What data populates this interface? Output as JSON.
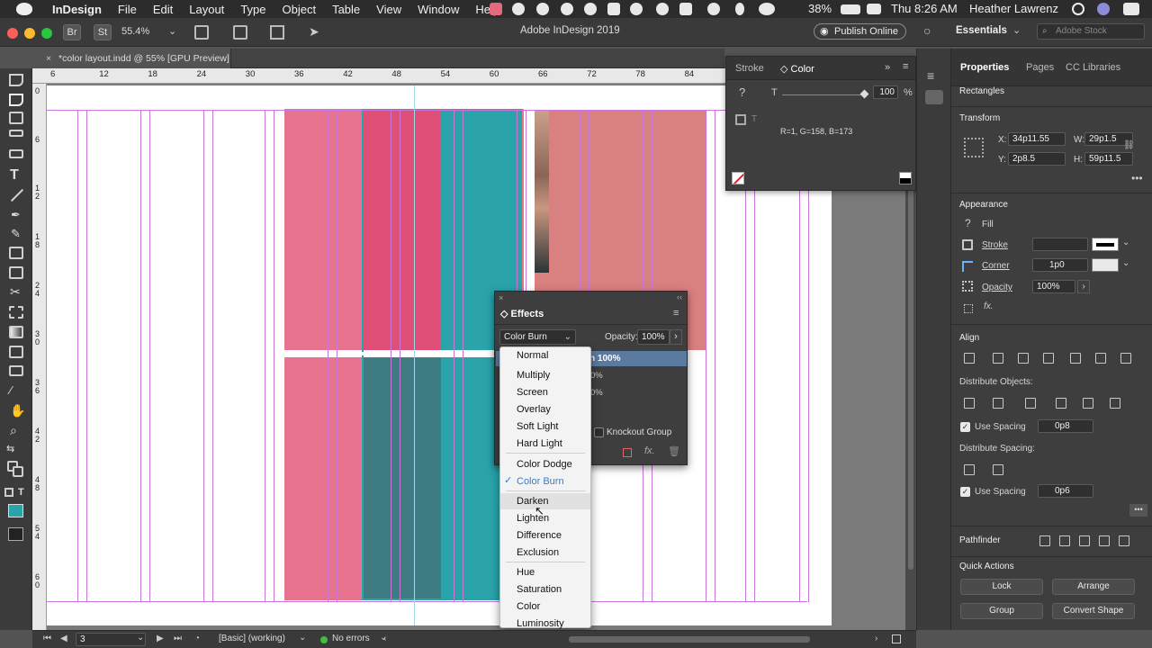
{
  "menubar": {
    "app_name": "InDesign",
    "menus": [
      "File",
      "Edit",
      "Layout",
      "Type",
      "Object",
      "Table",
      "View",
      "Window",
      "Help"
    ],
    "battery": "38%",
    "clock": "Thu 8:26 AM",
    "user": "Heather Lawrenz"
  },
  "app_bar": {
    "zoom": "55.4%",
    "title": "Adobe InDesign 2019",
    "publish_label": "Publish Online",
    "workspace": "Essentials",
    "search_placeholder": "Adobe Stock",
    "br_label": "Br",
    "st_label": "St"
  },
  "document_tab": {
    "title": "*color layout.indd @ 55% [GPU Preview]"
  },
  "ruler": {
    "h_ticks": [
      "6",
      "12",
      "18",
      "24",
      "30",
      "36",
      "42",
      "48",
      "54",
      "60",
      "66",
      "72",
      "78",
      "84"
    ],
    "v_ticks": [
      "0",
      "6",
      "1 2",
      "1 8",
      "2 4",
      "3 0",
      "3 6",
      "4 2",
      "4 8",
      "5 4",
      "6 0"
    ]
  },
  "color_panel": {
    "tab_stroke": "Stroke",
    "tab_color": "Color",
    "tint_value": "100",
    "tint_unit": "%",
    "rgb_readout": "R=1, G=158, B=173",
    "tint_label": "T"
  },
  "effects_panel": {
    "title": "Effects",
    "blend_mode": "Color Burn",
    "opacity_label": "Opacity:",
    "opacity_value": "100%",
    "selected_row": "n 100%",
    "row2": "0%",
    "row3": "0%",
    "knockout_label": "Knockout Group"
  },
  "blend_dropdown": {
    "options": [
      "Normal",
      "Multiply",
      "Screen",
      "Overlay",
      "Soft Light",
      "Hard Light",
      "Color Dodge",
      "Color Burn",
      "Darken",
      "Lighten",
      "Difference",
      "Exclusion",
      "Hue",
      "Saturation",
      "Color",
      "Luminosity"
    ],
    "selected": "Color Burn",
    "hovered": "Darken"
  },
  "properties": {
    "tabs": [
      "Properties",
      "Pages",
      "CC Libraries"
    ],
    "object_type": "Rectangles",
    "transform_label": "Transform",
    "x_label": "X:",
    "x_value": "34p11.55",
    "y_label": "Y:",
    "y_value": "2p8.5",
    "w_label": "W:",
    "w_value": "29p1.5",
    "h_label": "H:",
    "h_value": "59p11.5",
    "appearance_label": "Appearance",
    "fill_label": "Fill",
    "stroke_label": "Stroke",
    "corner_label": "Corner",
    "corner_value": "1p0",
    "opacity_label": "Opacity",
    "opacity_value": "100%",
    "align_label": "Align",
    "distribute_objects_label": "Distribute Objects:",
    "use_spacing_label": "Use Spacing",
    "spacing1_value": "0p8",
    "distribute_spacing_label": "Distribute Spacing:",
    "spacing2_value": "0p6",
    "pathfinder_label": "Pathfinder",
    "quick_actions_label": "Quick Actions",
    "lock_label": "Lock",
    "arrange_label": "Arrange",
    "group_label": "Group",
    "convert_shape_label": "Convert Shape",
    "fx_label": "fx."
  },
  "statusbar": {
    "page_number": "3",
    "preflight_profile": "[Basic] (working)",
    "errors": "No errors"
  },
  "colors": {
    "pink": "#e8738f",
    "pink_dark": "#df4f78",
    "teal": "#2aa3ab",
    "teal_dark": "#3e7b82",
    "salmon": "#d98080",
    "guide": "#c876d8"
  }
}
